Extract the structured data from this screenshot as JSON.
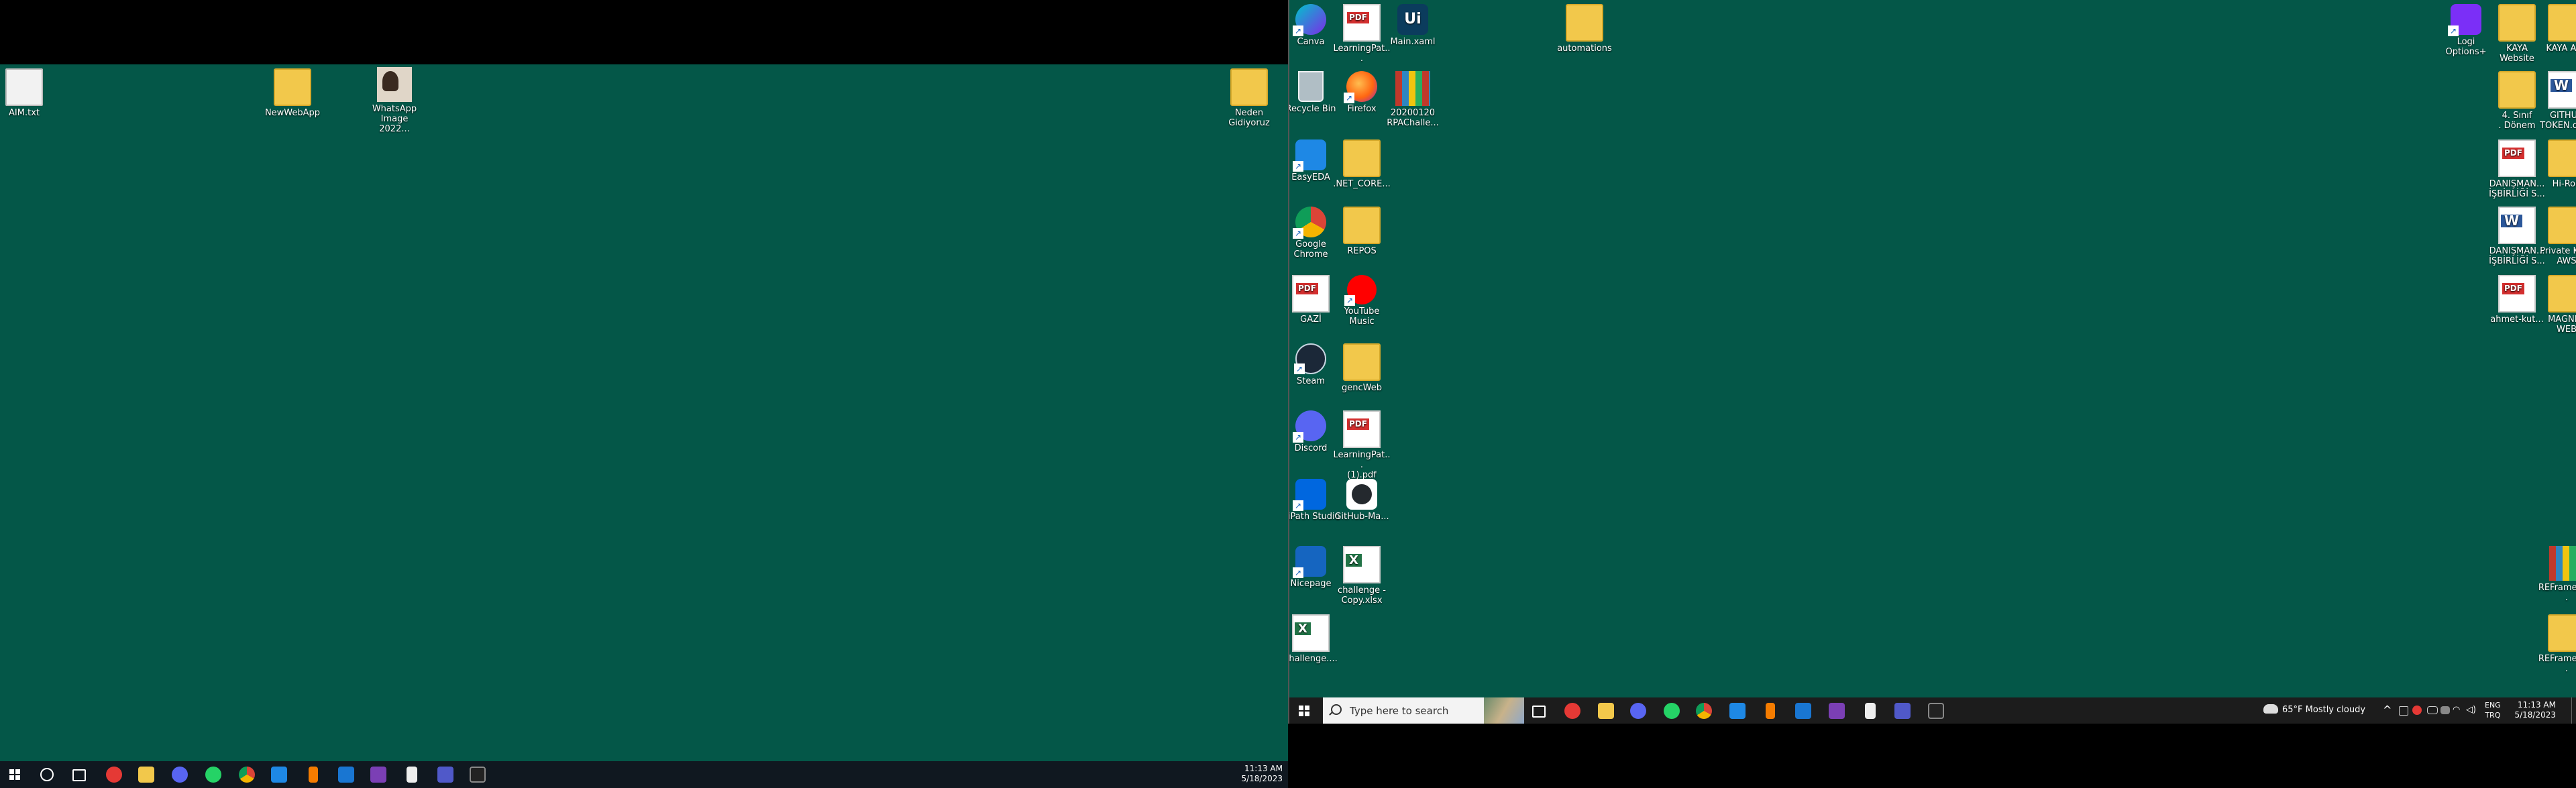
{
  "left_monitor": {
    "icons": [
      {
        "name": "file-icon",
        "label": "AIM.txt"
      },
      {
        "name": "folder-icon",
        "label": "NewWebApp"
      },
      {
        "name": "image-icon",
        "label": "WhatsApp\nImage 2022..."
      },
      {
        "name": "folder-icon",
        "label": "Neden\nGidiyoruz"
      }
    ],
    "taskbar": {
      "time": "11:13 AM",
      "date": "5/18/2023",
      "apps": [
        "start-icon",
        "search-icon",
        "task-view-icon",
        "youtube-music-icon",
        "file-explorer-icon",
        "discord-icon",
        "whatsapp-icon",
        "chrome-icon",
        "vscode-icon",
        "uipath-icon",
        "mail-icon",
        "visual-studio-icon",
        "notepad-icon",
        "teams-icon",
        "terminal-icon"
      ]
    }
  },
  "right_monitor": {
    "icons": [
      {
        "name": "canva-icon",
        "label": "Canva"
      },
      {
        "name": "pdf-icon",
        "label": "LearningPat..."
      },
      {
        "name": "uipath-file-icon",
        "label": "Main.xaml"
      },
      {
        "name": "folder-icon",
        "label": "automations"
      },
      {
        "name": "logi-options-icon",
        "label": "Logi\nOptions+"
      },
      {
        "name": "folder-icon",
        "label": "KAYA\nWebsite"
      },
      {
        "name": "folder-icon",
        "label": "KAYA A.Ş."
      },
      {
        "name": "recycle-bin-icon",
        "label": "Recycle Bin"
      },
      {
        "name": "firefox-icon",
        "label": "Firefox"
      },
      {
        "name": "zip-icon",
        "label": "20200120\nRPAChalle..."
      },
      {
        "name": "folder-icon",
        "label": "4. Sınıf\n. Dönem"
      },
      {
        "name": "word-icon",
        "label": "GITHUB\nTOKEN.docx"
      },
      {
        "name": "easyeda-icon",
        "label": "EasyEDA"
      },
      {
        "name": "folder-icon",
        "label": ".NET_CORE..."
      },
      {
        "name": "pdf-icon",
        "label": "DANIŞMAN...\nİŞBİRLİĞİ S..."
      },
      {
        "name": "folder-icon",
        "label": "Hi-Rob"
      },
      {
        "name": "chrome-icon",
        "label": "Google\nChrome"
      },
      {
        "name": "folder-icon",
        "label": "REPOS"
      },
      {
        "name": "word-icon",
        "label": "DANIŞMAN...\nİŞBİRLİĞİ S..."
      },
      {
        "name": "folder-icon",
        "label": "Private Keys\nAWS"
      },
      {
        "name": "pdf-icon",
        "label": "GAZİ"
      },
      {
        "name": "youtube-music-icon",
        "label": "YouTube\nMusic"
      },
      {
        "name": "pdf-icon",
        "label": "ahmet-kut..."
      },
      {
        "name": "folder-icon",
        "label": "MAGNET\nWEB"
      },
      {
        "name": "steam-icon",
        "label": "Steam"
      },
      {
        "name": "folder-icon",
        "label": "gencWeb"
      },
      {
        "name": "discord-icon",
        "label": "Discord"
      },
      {
        "name": "pdf-icon",
        "label": "LearningPat...\n(1).pdf"
      },
      {
        "name": "uipath-studio-icon",
        "label": "UiPath Studio"
      },
      {
        "name": "github-icon",
        "label": "GitHub-Ma..."
      },
      {
        "name": "nicepage-icon",
        "label": "Nicepage"
      },
      {
        "name": "excel-icon",
        "label": "challenge -\nCopy.xlsx"
      },
      {
        "name": "zip-icon",
        "label": "REFramewo..."
      },
      {
        "name": "excel-icon",
        "label": "challenge...."
      },
      {
        "name": "folder-icon",
        "label": "REFramewo..."
      }
    ],
    "taskbar": {
      "search_placeholder": "Type here to search",
      "weather": "65°F  Mostly cloudy",
      "lang_top": "ENG",
      "lang_bottom": "TRQ",
      "time": "11:13 AM",
      "date": "5/18/2023"
    }
  },
  "colors": {
    "desktop": "#045748",
    "taskbar_left": "#101820",
    "taskbar_right": "#1c1c1c"
  }
}
